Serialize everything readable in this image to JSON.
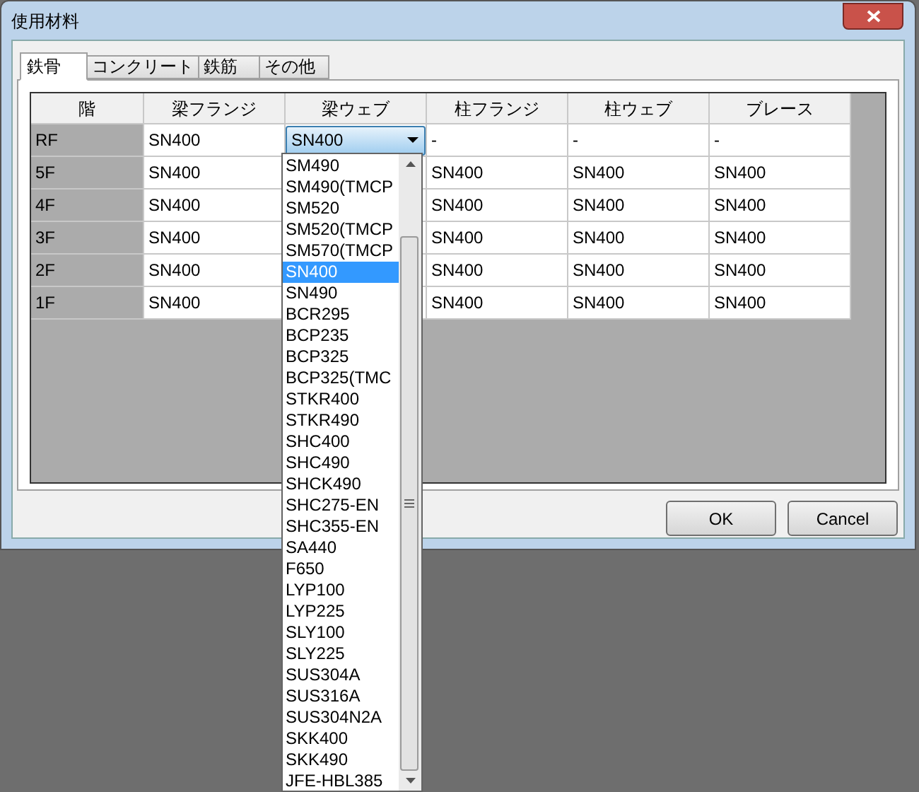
{
  "window": {
    "title": "使用材料"
  },
  "tabs": [
    {
      "label": "鉄骨",
      "selected": true
    },
    {
      "label": "コンクリート",
      "selected": false
    },
    {
      "label": "鉄筋",
      "selected": false
    },
    {
      "label": "その他",
      "selected": false
    }
  ],
  "table": {
    "columns": [
      "階",
      "梁フランジ",
      "梁ウェブ",
      "柱フランジ",
      "柱ウェブ",
      "ブレース"
    ],
    "rows": [
      {
        "floor": "RF",
        "cells": [
          {
            "kind": "text",
            "text": "SN400"
          },
          {
            "kind": "combo",
            "text": "SN400"
          },
          {
            "kind": "text",
            "text": "-"
          },
          {
            "kind": "text",
            "text": "-"
          },
          {
            "kind": "text",
            "text": "-"
          }
        ]
      },
      {
        "floor": "5F",
        "cells": [
          {
            "kind": "text",
            "text": "SN400"
          },
          {
            "kind": "covered"
          },
          {
            "kind": "text",
            "text": "SN400"
          },
          {
            "kind": "text",
            "text": "SN400"
          },
          {
            "kind": "text",
            "text": "SN400"
          }
        ]
      },
      {
        "floor": "4F",
        "cells": [
          {
            "kind": "text",
            "text": "SN400"
          },
          {
            "kind": "covered"
          },
          {
            "kind": "text",
            "text": "SN400"
          },
          {
            "kind": "text",
            "text": "SN400"
          },
          {
            "kind": "text",
            "text": "SN400"
          }
        ]
      },
      {
        "floor": "3F",
        "cells": [
          {
            "kind": "text",
            "text": "SN400"
          },
          {
            "kind": "covered"
          },
          {
            "kind": "text",
            "text": "SN400"
          },
          {
            "kind": "text",
            "text": "SN400"
          },
          {
            "kind": "text",
            "text": "SN400"
          }
        ]
      },
      {
        "floor": "2F",
        "cells": [
          {
            "kind": "text",
            "text": "SN400"
          },
          {
            "kind": "covered"
          },
          {
            "kind": "text",
            "text": "SN400"
          },
          {
            "kind": "text",
            "text": "SN400"
          },
          {
            "kind": "text",
            "text": "SN400"
          }
        ]
      },
      {
        "floor": "1F",
        "cells": [
          {
            "kind": "text",
            "text": "SN400"
          },
          {
            "kind": "covered"
          },
          {
            "kind": "text",
            "text": "SN400"
          },
          {
            "kind": "text",
            "text": "SN400"
          },
          {
            "kind": "text",
            "text": "SN400"
          }
        ]
      }
    ]
  },
  "dropdown": {
    "items": [
      {
        "label": "SM490",
        "selected": false
      },
      {
        "label": "SM490(TMCP",
        "selected": false
      },
      {
        "label": "SM520",
        "selected": false
      },
      {
        "label": "SM520(TMCP",
        "selected": false
      },
      {
        "label": "SM570(TMCP",
        "selected": false
      },
      {
        "label": "SN400",
        "selected": true
      },
      {
        "label": "SN490",
        "selected": false
      },
      {
        "label": "BCR295",
        "selected": false
      },
      {
        "label": "BCP235",
        "selected": false
      },
      {
        "label": "BCP325",
        "selected": false
      },
      {
        "label": "BCP325(TMC",
        "selected": false
      },
      {
        "label": "STKR400",
        "selected": false
      },
      {
        "label": "STKR490",
        "selected": false
      },
      {
        "label": "SHC400",
        "selected": false
      },
      {
        "label": "SHC490",
        "selected": false
      },
      {
        "label": "SHCK490",
        "selected": false
      },
      {
        "label": "SHC275-EN",
        "selected": false
      },
      {
        "label": "SHC355-EN",
        "selected": false
      },
      {
        "label": "SA440",
        "selected": false
      },
      {
        "label": "F650",
        "selected": false
      },
      {
        "label": "LYP100",
        "selected": false
      },
      {
        "label": "LYP225",
        "selected": false
      },
      {
        "label": "SLY100",
        "selected": false
      },
      {
        "label": "SLY225",
        "selected": false
      },
      {
        "label": "SUS304A",
        "selected": false
      },
      {
        "label": "SUS316A",
        "selected": false
      },
      {
        "label": "SUS304N2A",
        "selected": false
      },
      {
        "label": "SKK400",
        "selected": false
      },
      {
        "label": "SKK490",
        "selected": false
      },
      {
        "label": "JFE-HBL385",
        "selected": false
      }
    ]
  },
  "buttons": [
    "OK",
    "Cancel"
  ]
}
